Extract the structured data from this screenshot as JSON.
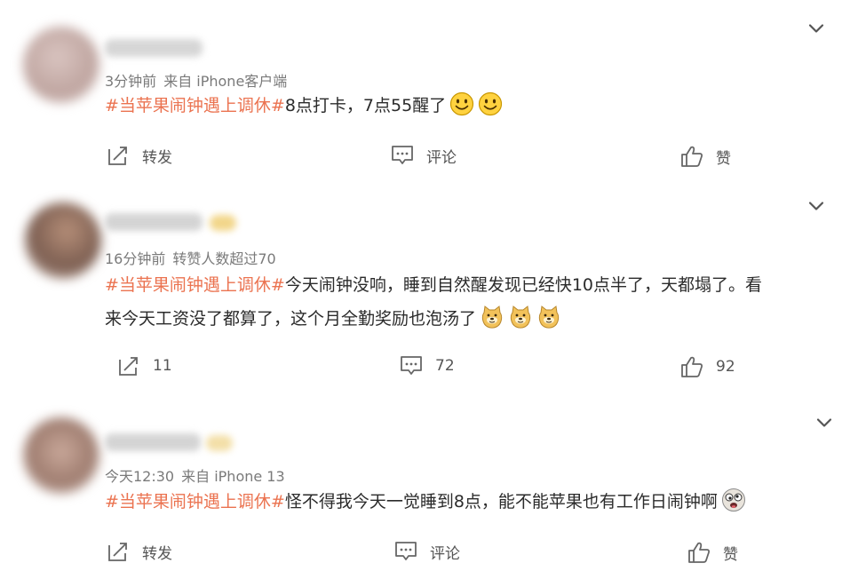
{
  "posts": [
    {
      "meta": {
        "time": "3分钟前",
        "source": "来自 iPhone客户端"
      },
      "hashtag": "#当苹果闹钟遇上调休#",
      "text": "8点打卡，7点55醒了",
      "emojis": [
        "smile-emoji",
        "smile-emoji"
      ],
      "actions": {
        "repost": "转发",
        "comment": "评论",
        "like": "赞"
      }
    },
    {
      "meta": {
        "time": "16分钟前",
        "source": "转赞人数超过70"
      },
      "hashtag": "#当苹果闹钟遇上调休#",
      "text_line1": "今天闹钟没响，睡到自然醒发现已经快10点半了，天都塌了。看",
      "text_line2": "来今天工资没了都算了，这个月全勤奖励也泡汤了",
      "emojis": [
        "doge-emoji",
        "doge-emoji",
        "doge-emoji"
      ],
      "actions": {
        "repost": "11",
        "comment": "72",
        "like": "92"
      }
    },
    {
      "meta": {
        "time": "今天12:30",
        "source": "来自 iPhone 13"
      },
      "hashtag": "#当苹果闹钟遇上调休#",
      "text": "怪不得我今天一觉睡到8点，能不能苹果也有工作日闹钟啊",
      "emojis": [
        "crazy-face-emoji"
      ],
      "actions": {
        "repost": "转发",
        "comment": "评论",
        "like": "赞"
      }
    }
  ],
  "colors": {
    "hashtag": "#eb7350",
    "meta": "#7a7a7a",
    "text": "#2b2b2b"
  }
}
